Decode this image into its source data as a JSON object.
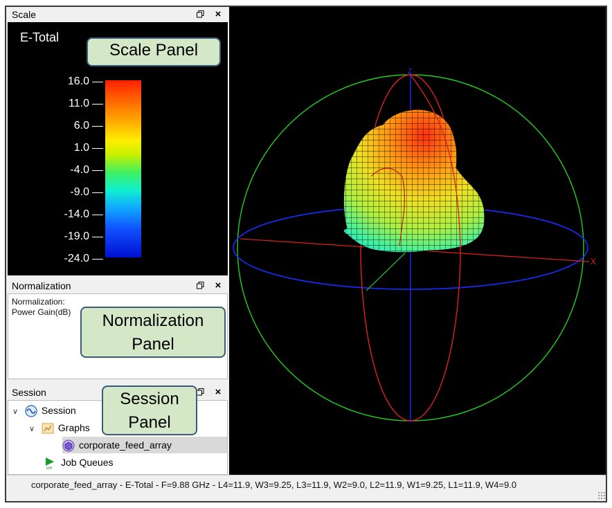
{
  "panels": {
    "scale": {
      "title": "Scale",
      "quantity": "E-Total"
    },
    "normalization": {
      "title": "Normalization",
      "text_line1": "Normalization:",
      "text_line2": "Power Gain(dB)"
    },
    "session": {
      "title": "Session"
    }
  },
  "scale_ticks": [
    "16.0",
    "11.0",
    "6.0",
    "1.0",
    "-4.0",
    "-9.0",
    "-14.0",
    "-19.0",
    "-24.0"
  ],
  "tree": {
    "session": "Session",
    "graphs": "Graphs",
    "graph_item": "corporate_feed_array",
    "job_queues": "Job Queues"
  },
  "axes": {
    "x": "X",
    "z": "Z"
  },
  "status": "corporate_feed_array - E-Total - F=9.88 GHz - L4=11.9, W3=9.25, L3=11.9, W2=9.0, L2=11.9, W1=9.25, L1=11.9, W4=9.0",
  "callouts": {
    "scale": "Scale Panel",
    "normalization_l1": "Normalization",
    "normalization_l2": "Panel",
    "session_l1": "Session",
    "session_l2": "Panel"
  },
  "colors": {
    "sphere_green": "#20d020",
    "sphere_red": "#e02020",
    "sphere_blue": "#1a2cff",
    "callout_fill": "#d4e8c8",
    "callout_border": "#3a5a7a"
  }
}
